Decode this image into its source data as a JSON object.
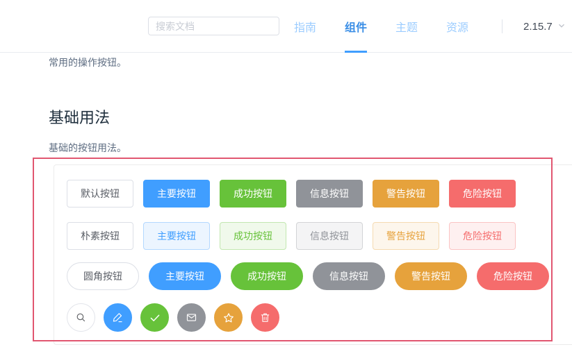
{
  "header": {
    "search_placeholder": "搜索文档",
    "nav_items": [
      "指南",
      "组件",
      "主题",
      "资源"
    ],
    "active_nav": "组件",
    "version": "2.15.7"
  },
  "page": {
    "intro": "常用的操作按钮。",
    "section_title": "基础用法",
    "section_desc": "基础的按钮用法。"
  },
  "demo": {
    "row_default": [
      "默认按钮",
      "主要按钮",
      "成功按钮",
      "信息按钮",
      "警告按钮",
      "危险按钮"
    ],
    "row_plain": [
      "朴素按钮",
      "主要按钮",
      "成功按钮",
      "信息按钮",
      "警告按钮",
      "危险按钮"
    ],
    "row_round": [
      "圆角按钮",
      "主要按钮",
      "成功按钮",
      "信息按钮",
      "警告按钮",
      "危险按钮"
    ],
    "row_circle_icons": [
      "search",
      "edit",
      "check",
      "message",
      "star",
      "delete"
    ]
  },
  "colors": {
    "primary": "#409EFF",
    "success": "#67C23A",
    "info": "#909399",
    "warning": "#E6A23C",
    "danger": "#F56C6C",
    "annotation_box": "#E15670"
  }
}
